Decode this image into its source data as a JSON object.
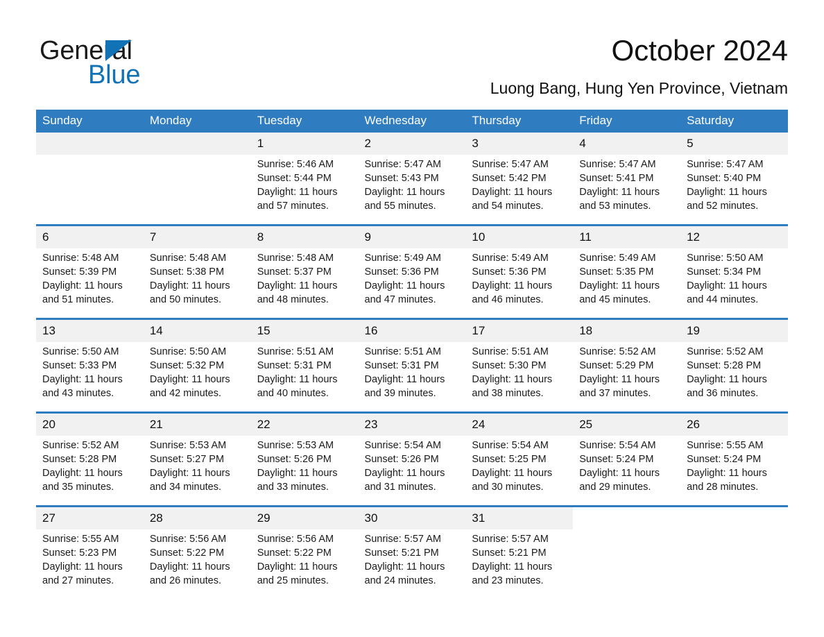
{
  "brand": {
    "line1": "General",
    "line2": "Blue",
    "triangle_color": "#1272b6",
    "blue_color": "#1272b6"
  },
  "header": {
    "title": "October 2024",
    "subtitle": "Luong Bang, Hung Yen Province, Vietnam"
  },
  "theme": {
    "header_blue": "#2f7cc0",
    "day_band_gray": "#f1f1f1",
    "text_black": "#111111"
  },
  "weekday_headers": [
    "Sunday",
    "Monday",
    "Tuesday",
    "Wednesday",
    "Thursday",
    "Friday",
    "Saturday"
  ],
  "weeks": [
    [
      {
        "day": "",
        "blank": true,
        "lead": true
      },
      {
        "day": "",
        "blank": true,
        "lead": true
      },
      {
        "day": "1",
        "sunrise": "Sunrise: 5:46 AM",
        "sunset": "Sunset: 5:44 PM",
        "daylight1": "Daylight: 11 hours",
        "daylight2": "and 57 minutes."
      },
      {
        "day": "2",
        "sunrise": "Sunrise: 5:47 AM",
        "sunset": "Sunset: 5:43 PM",
        "daylight1": "Daylight: 11 hours",
        "daylight2": "and 55 minutes."
      },
      {
        "day": "3",
        "sunrise": "Sunrise: 5:47 AM",
        "sunset": "Sunset: 5:42 PM",
        "daylight1": "Daylight: 11 hours",
        "daylight2": "and 54 minutes."
      },
      {
        "day": "4",
        "sunrise": "Sunrise: 5:47 AM",
        "sunset": "Sunset: 5:41 PM",
        "daylight1": "Daylight: 11 hours",
        "daylight2": "and 53 minutes."
      },
      {
        "day": "5",
        "sunrise": "Sunrise: 5:47 AM",
        "sunset": "Sunset: 5:40 PM",
        "daylight1": "Daylight: 11 hours",
        "daylight2": "and 52 minutes."
      }
    ],
    [
      {
        "day": "6",
        "sunrise": "Sunrise: 5:48 AM",
        "sunset": "Sunset: 5:39 PM",
        "daylight1": "Daylight: 11 hours",
        "daylight2": "and 51 minutes."
      },
      {
        "day": "7",
        "sunrise": "Sunrise: 5:48 AM",
        "sunset": "Sunset: 5:38 PM",
        "daylight1": "Daylight: 11 hours",
        "daylight2": "and 50 minutes."
      },
      {
        "day": "8",
        "sunrise": "Sunrise: 5:48 AM",
        "sunset": "Sunset: 5:37 PM",
        "daylight1": "Daylight: 11 hours",
        "daylight2": "and 48 minutes."
      },
      {
        "day": "9",
        "sunrise": "Sunrise: 5:49 AM",
        "sunset": "Sunset: 5:36 PM",
        "daylight1": "Daylight: 11 hours",
        "daylight2": "and 47 minutes."
      },
      {
        "day": "10",
        "sunrise": "Sunrise: 5:49 AM",
        "sunset": "Sunset: 5:36 PM",
        "daylight1": "Daylight: 11 hours",
        "daylight2": "and 46 minutes."
      },
      {
        "day": "11",
        "sunrise": "Sunrise: 5:49 AM",
        "sunset": "Sunset: 5:35 PM",
        "daylight1": "Daylight: 11 hours",
        "daylight2": "and 45 minutes."
      },
      {
        "day": "12",
        "sunrise": "Sunrise: 5:50 AM",
        "sunset": "Sunset: 5:34 PM",
        "daylight1": "Daylight: 11 hours",
        "daylight2": "and 44 minutes."
      }
    ],
    [
      {
        "day": "13",
        "sunrise": "Sunrise: 5:50 AM",
        "sunset": "Sunset: 5:33 PM",
        "daylight1": "Daylight: 11 hours",
        "daylight2": "and 43 minutes."
      },
      {
        "day": "14",
        "sunrise": "Sunrise: 5:50 AM",
        "sunset": "Sunset: 5:32 PM",
        "daylight1": "Daylight: 11 hours",
        "daylight2": "and 42 minutes."
      },
      {
        "day": "15",
        "sunrise": "Sunrise: 5:51 AM",
        "sunset": "Sunset: 5:31 PM",
        "daylight1": "Daylight: 11 hours",
        "daylight2": "and 40 minutes."
      },
      {
        "day": "16",
        "sunrise": "Sunrise: 5:51 AM",
        "sunset": "Sunset: 5:31 PM",
        "daylight1": "Daylight: 11 hours",
        "daylight2": "and 39 minutes."
      },
      {
        "day": "17",
        "sunrise": "Sunrise: 5:51 AM",
        "sunset": "Sunset: 5:30 PM",
        "daylight1": "Daylight: 11 hours",
        "daylight2": "and 38 minutes."
      },
      {
        "day": "18",
        "sunrise": "Sunrise: 5:52 AM",
        "sunset": "Sunset: 5:29 PM",
        "daylight1": "Daylight: 11 hours",
        "daylight2": "and 37 minutes."
      },
      {
        "day": "19",
        "sunrise": "Sunrise: 5:52 AM",
        "sunset": "Sunset: 5:28 PM",
        "daylight1": "Daylight: 11 hours",
        "daylight2": "and 36 minutes."
      }
    ],
    [
      {
        "day": "20",
        "sunrise": "Sunrise: 5:52 AM",
        "sunset": "Sunset: 5:28 PM",
        "daylight1": "Daylight: 11 hours",
        "daylight2": "and 35 minutes."
      },
      {
        "day": "21",
        "sunrise": "Sunrise: 5:53 AM",
        "sunset": "Sunset: 5:27 PM",
        "daylight1": "Daylight: 11 hours",
        "daylight2": "and 34 minutes."
      },
      {
        "day": "22",
        "sunrise": "Sunrise: 5:53 AM",
        "sunset": "Sunset: 5:26 PM",
        "daylight1": "Daylight: 11 hours",
        "daylight2": "and 33 minutes."
      },
      {
        "day": "23",
        "sunrise": "Sunrise: 5:54 AM",
        "sunset": "Sunset: 5:26 PM",
        "daylight1": "Daylight: 11 hours",
        "daylight2": "and 31 minutes."
      },
      {
        "day": "24",
        "sunrise": "Sunrise: 5:54 AM",
        "sunset": "Sunset: 5:25 PM",
        "daylight1": "Daylight: 11 hours",
        "daylight2": "and 30 minutes."
      },
      {
        "day": "25",
        "sunrise": "Sunrise: 5:54 AM",
        "sunset": "Sunset: 5:24 PM",
        "daylight1": "Daylight: 11 hours",
        "daylight2": "and 29 minutes."
      },
      {
        "day": "26",
        "sunrise": "Sunrise: 5:55 AM",
        "sunset": "Sunset: 5:24 PM",
        "daylight1": "Daylight: 11 hours",
        "daylight2": "and 28 minutes."
      }
    ],
    [
      {
        "day": "27",
        "sunrise": "Sunrise: 5:55 AM",
        "sunset": "Sunset: 5:23 PM",
        "daylight1": "Daylight: 11 hours",
        "daylight2": "and 27 minutes."
      },
      {
        "day": "28",
        "sunrise": "Sunrise: 5:56 AM",
        "sunset": "Sunset: 5:22 PM",
        "daylight1": "Daylight: 11 hours",
        "daylight2": "and 26 minutes."
      },
      {
        "day": "29",
        "sunrise": "Sunrise: 5:56 AM",
        "sunset": "Sunset: 5:22 PM",
        "daylight1": "Daylight: 11 hours",
        "daylight2": "and 25 minutes."
      },
      {
        "day": "30",
        "sunrise": "Sunrise: 5:57 AM",
        "sunset": "Sunset: 5:21 PM",
        "daylight1": "Daylight: 11 hours",
        "daylight2": "and 24 minutes."
      },
      {
        "day": "31",
        "sunrise": "Sunrise: 5:57 AM",
        "sunset": "Sunset: 5:21 PM",
        "daylight1": "Daylight: 11 hours",
        "daylight2": "and 23 minutes."
      },
      {
        "day": "",
        "blank": true,
        "trail": true
      },
      {
        "day": "",
        "blank": true,
        "trail": true
      }
    ]
  ]
}
